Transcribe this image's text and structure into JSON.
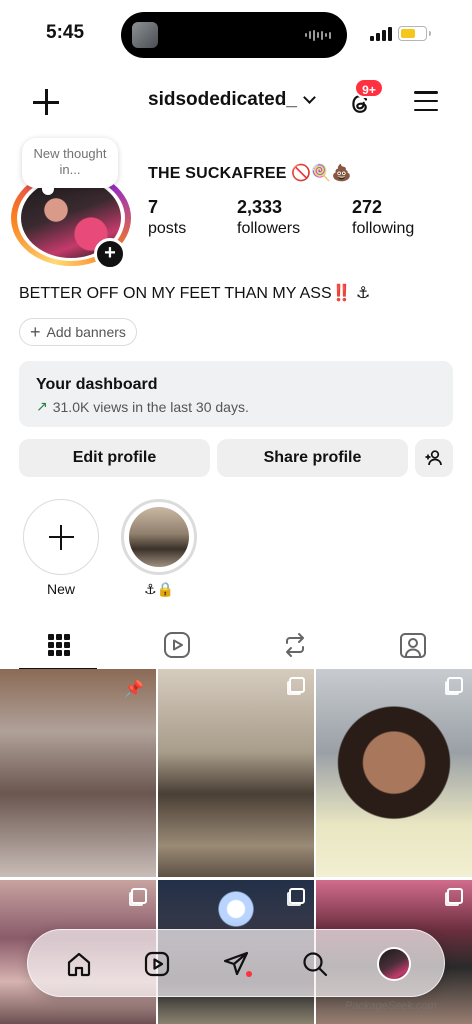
{
  "status_bar": {
    "time": "5:45"
  },
  "header": {
    "username": "sidsodedicated_",
    "notification_count": "9+"
  },
  "profile": {
    "note": "New thought in...",
    "display_name": "THE SUCKAFREE 🚫🍭💩",
    "stats": [
      {
        "number": "7",
        "label": "posts"
      },
      {
        "number": "2,333",
        "label": "followers"
      },
      {
        "number": "272",
        "label": "following"
      }
    ],
    "bio": "BETTER OFF ON MY FEET THAN MY ASS‼️ ⚓",
    "add_banners": "Add banners"
  },
  "dashboard": {
    "title": "Your dashboard",
    "subtitle": "31.0K views in the last 30 days."
  },
  "actions": {
    "edit": "Edit profile",
    "share": "Share profile"
  },
  "highlights": [
    {
      "label": "New"
    },
    {
      "label": "⚓🔒"
    }
  ],
  "tabs": [
    "grid-icon",
    "reels-icon",
    "reposts-icon",
    "tagged-icon"
  ],
  "watermark": "PackageSeek.com",
  "colors": {
    "badge": "#ff3040",
    "dashboard_bg": "#f0f1f3",
    "button_bg": "#efefef",
    "trend": "#2e7d4a"
  }
}
